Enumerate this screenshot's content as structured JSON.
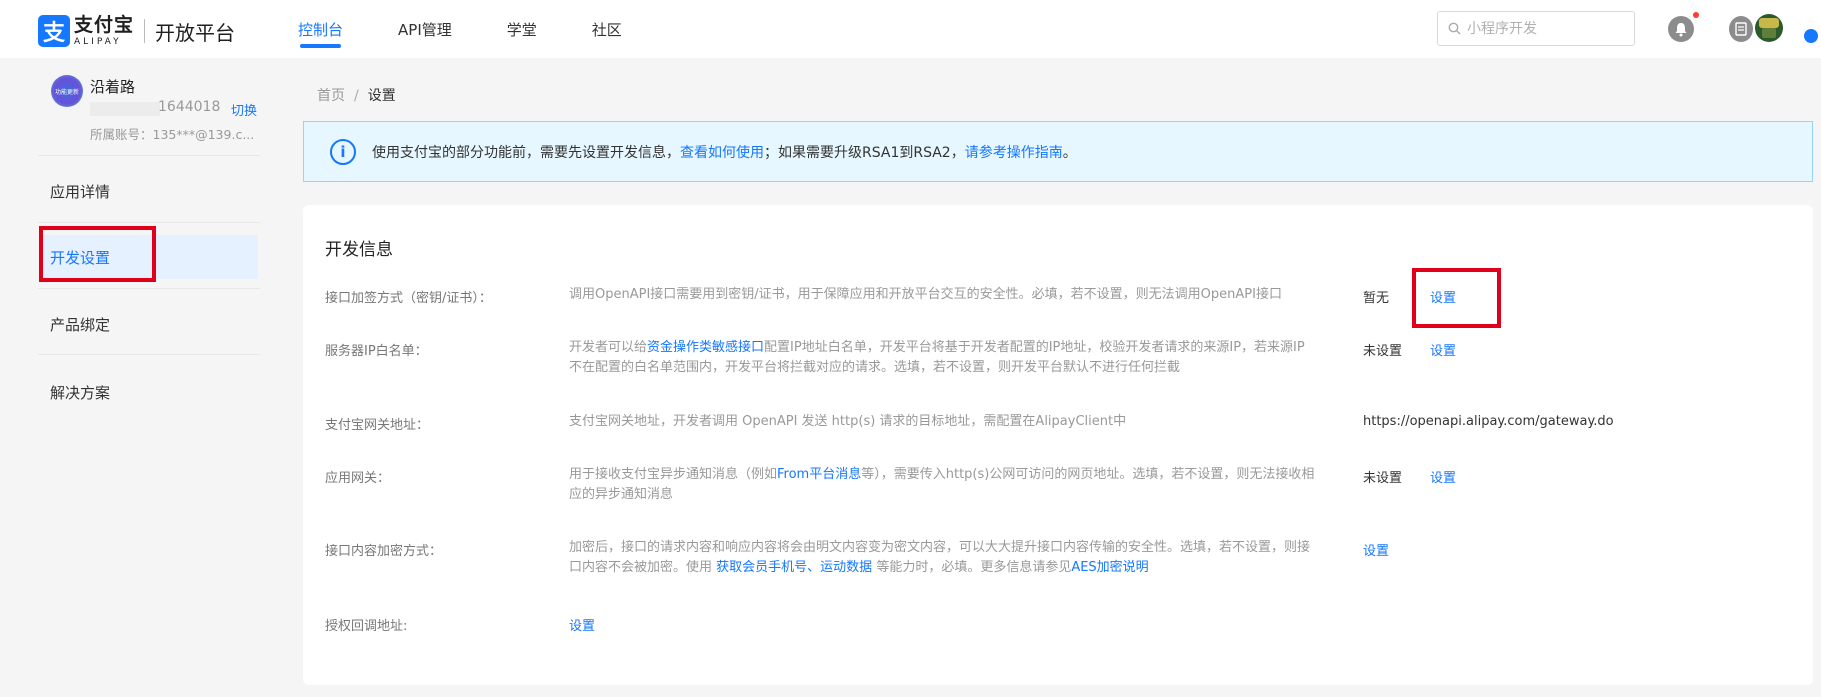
{
  "header": {
    "logo_mark": "支",
    "logo_cn": "支付宝",
    "logo_en": "ALIPAY",
    "logo_platform": "开放平台",
    "nav": [
      {
        "label": "控制台",
        "active": true
      },
      {
        "label": "API管理",
        "active": false
      },
      {
        "label": "学堂",
        "active": false
      },
      {
        "label": "社区",
        "active": false
      }
    ],
    "search_placeholder": "小程序开发"
  },
  "sidebar": {
    "app_avatar_text": "功能更新",
    "app_name": "沿着路",
    "app_id": "1644018",
    "switch_label": "切换",
    "account": "所属账号：135***@139.c...",
    "items": [
      {
        "label": "应用详情"
      },
      {
        "label": "开发设置",
        "active": true
      },
      {
        "label": "产品绑定"
      },
      {
        "label": "解决方案"
      }
    ]
  },
  "breadcrumb": {
    "home": "首页",
    "sep": "/",
    "current": "设置"
  },
  "notice": {
    "icon": "i",
    "text1": "使用支付宝的部分功能前，需要先设置开发信息，",
    "link1": "查看如何使用",
    "text2": "；如果需要升级RSA1到RSA2，",
    "link2": "请参考操作指南",
    "text3": "。"
  },
  "dev_info": {
    "title": "开发信息",
    "rows": [
      {
        "label": "接口加签方式（密钥/证书）：",
        "desc": "调用OpenAPI接口需要用到密钥/证书，用于保障应用和开放平台交互的安全性。必填，若不设置，则无法调用OpenAPI接口",
        "status": "暂无",
        "action": "设置"
      },
      {
        "label": "服务器IP白名单：",
        "desc_pre": "开发者可以给",
        "desc_link": "资金操作类敏感接口",
        "desc_post": "配置IP地址白名单，开发平台将基于开发者配置的IP地址，校验开发者请求的来源IP，若来源IP不在配置的白名单范围内，开发平台将拦截对应的请求。选填，若不设置，则开发平台默认不进行任何拦截",
        "status": "未设置",
        "action": "设置"
      },
      {
        "label": "支付宝网关地址：",
        "desc": "支付宝网关地址，开发者调用 OpenAPI 发送 http(s) 请求的目标地址，需配置在AlipayClient中",
        "status": "https://openapi.alipay.com/gateway.do"
      },
      {
        "label": "应用网关：",
        "desc_pre": "用于接收支付宝异步通知消息（例如",
        "desc_link": "From平台消息",
        "desc_post": "等），需要传入http(s)公网可访问的网页地址。选填，若不设置，则无法接收相应的异步通知消息",
        "status": "未设置",
        "action": "设置"
      },
      {
        "label": "接口内容加密方式：",
        "desc_pre": "加密后，接口的请求内容和响应内容将会由明文内容变为密文内容，可以大大提升接口内容传输的安全性。选填，若不设置，则接口内容不会被加密。使用 ",
        "desc_link1": "获取会员手机号",
        "desc_mid": "、",
        "desc_link2": "运动数据",
        "desc_mid2": " 等能力时，必填。更多信息请参见",
        "desc_link3": "AES加密说明",
        "action": "设置"
      },
      {
        "label": "授权回调地址:",
        "action": "设置"
      }
    ]
  }
}
